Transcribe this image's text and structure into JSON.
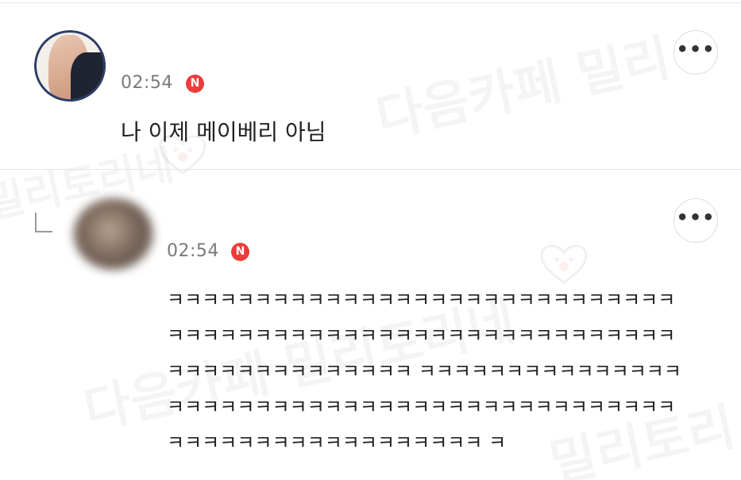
{
  "comments": [
    {
      "time": "02:54",
      "badge": "N",
      "text": "나 이제 메이베리 아님",
      "more_label": "•••"
    }
  ],
  "reply": {
    "time": "02:54",
    "badge": "N",
    "text": "ㅋㅋㅋㅋㅋㅋㅋㅋㅋㅋㅋㅋㅋㅋㅋㅋㅋㅋㅋㅋㅋㅋㅋㅋㅋㅋㅋㅋㅋㅋㅋㅋㅋㅋㅋㅋㅋㅋㅋㅋㅋㅋㅋㅋㅋㅋㅋㅋㅋㅋㅋㅋㅋㅋㅋㅋㅋㅋㅋㅋㅋㅋㅋㅋㅋㅋㅋㅋㅋㅋㅋㅋ ㅋㅋㅋㅋㅋㅋㅋㅋㅋㅋㅋㅋㅋㅋㅋㅋㅋㅋㅋㅋㅋㅋㅋㅋㅋㅋㅋㅋㅋㅋㅋㅋㅋㅋㅋㅋㅋㅋㅋㅋㅋㅋㅋㅋㅋㅋㅋㅋㅋㅋㅋㅋㅋㅋㅋㅋㅋㅋㅋㅋㅋㅋ ㅋ",
    "more_label": "•••"
  },
  "watermarks": {
    "line1": "다음카페 밀리",
    "line2": "밀리토리네",
    "line3": "다음카페 밀리토리네",
    "line4": "밀리토리"
  },
  "colors": {
    "badge": "#ee3b3b",
    "time": "#7a7a7a",
    "divider": "#e6e6e6"
  }
}
